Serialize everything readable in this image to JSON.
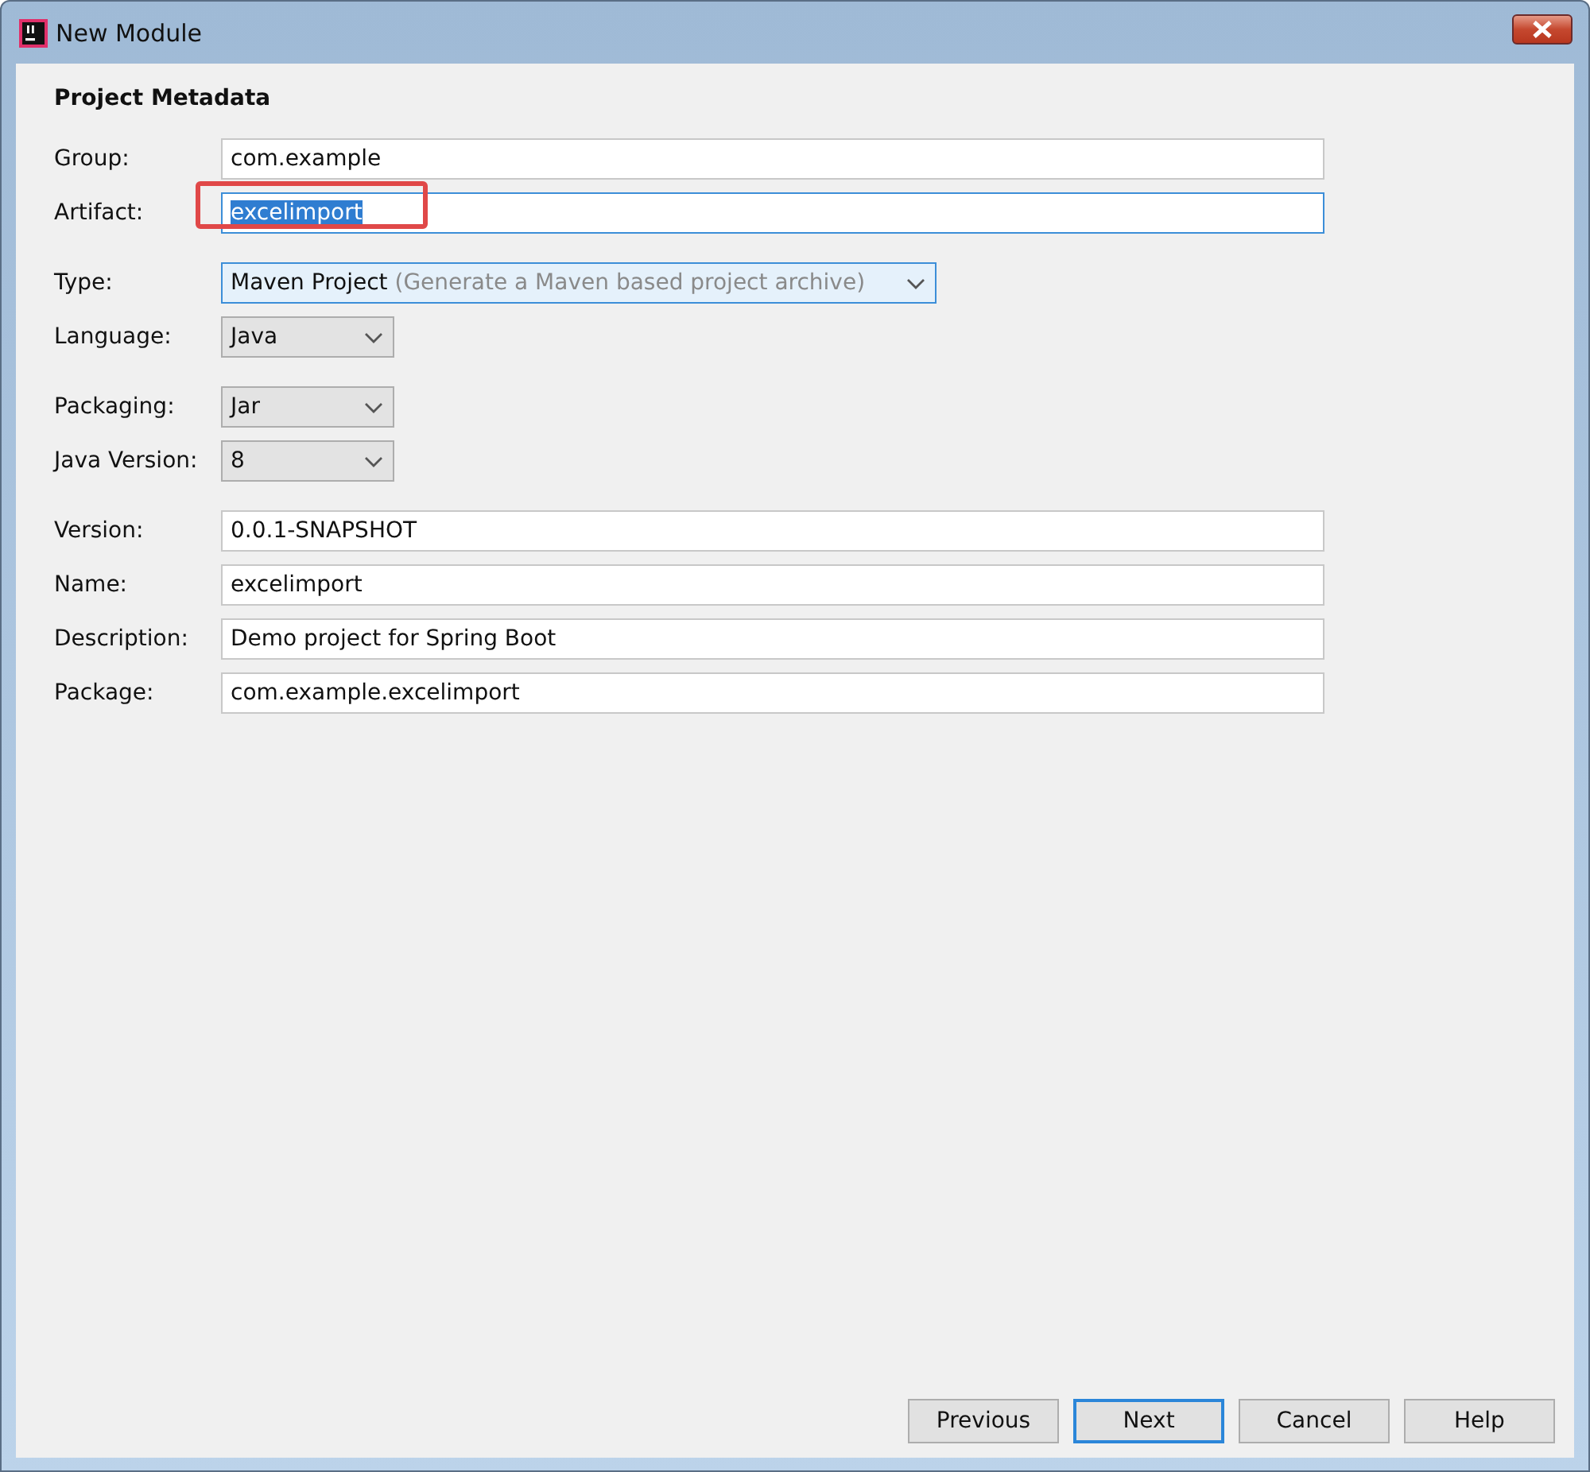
{
  "window": {
    "title": "New Module"
  },
  "section_title": "Project Metadata",
  "groups": [
    {
      "fields": [
        {
          "label": "Group:",
          "kind": "text",
          "value": "com.example",
          "focused": false,
          "text_selected": false,
          "highlighted": false
        },
        {
          "label": "Artifact:",
          "kind": "text",
          "value": "excelimport",
          "focused": true,
          "text_selected": true,
          "highlighted": true
        }
      ]
    },
    {
      "fields": [
        {
          "label": "Type:",
          "kind": "wide-select",
          "value": "Maven Project",
          "hint": "(Generate a Maven based project archive)",
          "focused": true
        },
        {
          "label": "Language:",
          "kind": "select",
          "value": "Java",
          "focused": false
        }
      ]
    },
    {
      "fields": [
        {
          "label": "Packaging:",
          "kind": "select",
          "value": "Jar",
          "focused": false
        },
        {
          "label": "Java Version:",
          "kind": "select",
          "value": "8",
          "focused": false
        }
      ]
    },
    {
      "fields": [
        {
          "label": "Version:",
          "kind": "text",
          "value": "0.0.1-SNAPSHOT",
          "focused": false,
          "text_selected": false,
          "highlighted": false
        },
        {
          "label": "Name:",
          "kind": "text",
          "value": "excelimport",
          "focused": false,
          "text_selected": false,
          "highlighted": false
        },
        {
          "label": "Description:",
          "kind": "text",
          "value": "Demo project for Spring Boot",
          "focused": false,
          "text_selected": false,
          "highlighted": false
        },
        {
          "label": "Package:",
          "kind": "text",
          "value": "com.example.excelimport",
          "focused": false,
          "text_selected": false,
          "highlighted": false
        }
      ]
    }
  ],
  "buttons": [
    {
      "label": "Previous",
      "default": false
    },
    {
      "label": "Next",
      "default": true
    },
    {
      "label": "Cancel",
      "default": false
    },
    {
      "label": "Help",
      "default": false
    }
  ]
}
